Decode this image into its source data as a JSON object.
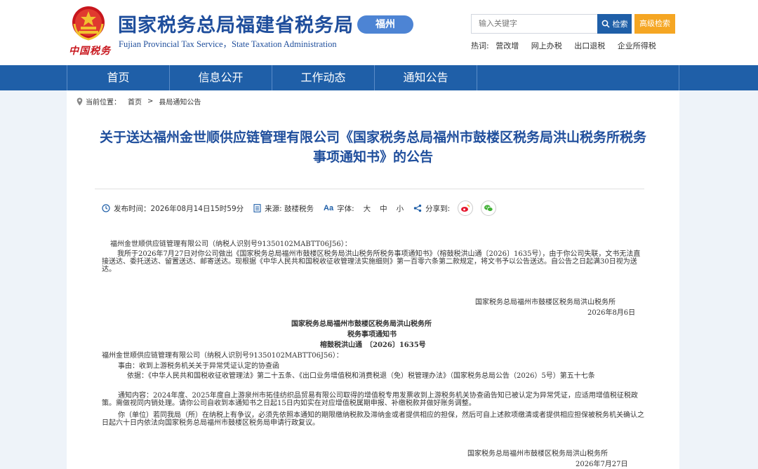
{
  "header": {
    "brand_mark": "中国税务",
    "title": "国家税务总局福建省税务局",
    "subtitle": "Fujian Provincial Tax Service，State Taxation Administration",
    "region_badge": "福州",
    "search": {
      "placeholder": "输入关键字",
      "button_label": "检索",
      "advanced_label": "高级检索"
    },
    "hot": {
      "label": "热词:",
      "items": [
        "营改增",
        "网上办税",
        "出口退税",
        "企业所得税"
      ]
    }
  },
  "nav": {
    "items": [
      "首页",
      "信息公开",
      "工作动态",
      "通知公告"
    ]
  },
  "breadcrumb": {
    "label": "当前位置：",
    "home": "首页",
    "sep": ">",
    "current": "县局通知公告"
  },
  "article": {
    "title": "关于送达福州金世顺供应链管理有限公司《国家税务总局福州市鼓楼区税务局洪山税务所税务事项通知书》的公告",
    "meta": {
      "publish": "发布时间：2026年08月14日15时59分",
      "source": "来源: 鼓楼税务",
      "font_label": "字体:",
      "font_sizes": [
        "大",
        "中",
        "小"
      ],
      "share_label": "分享到:"
    },
    "body": {
      "addressee": "福州金世顺供应链管理有限公司（纳税人识别号91350102MABTT06J56）：",
      "p1": "我所于2026年7月27日对你公司做出《国家税务总局福州市鼓楼区税务局洪山税务所税务事项通知书》（榕鼓税洪山通〔2026〕1635号），由于你公司失联，文书无法直接送达、委托送达、留置送达、邮寄送达。现根据《中华人民共和国税收征收管理法实施细则》第一百零六条第二款规定，将文书予以公告送达。自公告之日起满30日视为送达。",
      "sign1_org": "国家税务总局福州市鼓楼区税务局洪山税务所",
      "sign1_date": "2026年8月6日",
      "notice_org": "国家税务总局福州市鼓楼区税务局洪山税务所",
      "notice_name": "税务事项通知书",
      "notice_no": "榕鼓税洪山通　〔2026〕1635号",
      "notice_addressee": "福州金世顺供应链管理有限公司（纳税人识别号91350102MABTT06J56）：",
      "reason": "事由：收到上游税务机关关于异常凭证认定的协查函",
      "basis": "依据：《中华人民共和国税收征收管理法》第二十五条、《出口业务增值税和消费税退（免）税管理办法》（国家税务总局公告（2026）5号）第五十七条",
      "content": "通知内容：2024年度、2025年度自上游泉州市拓佳纺织品贸易有限公司取得的增值税专用发票收到上游税务机关协查函告知已被认定为异常凭证，应适用增值税征税政策。需做视同内销处理。请你公司自收到本通知书之日起15日内如实在对应增值税属期申报、补缴税款并做好账务调整。",
      "appeal": "你（单位）若同我局（所）在纳税上有争议，必须先依照本通知的期限缴纳税款及滞纳金或者提供相应的担保，然后可自上述款项缴清或者提供相应担保被税务机关确认之日起六十日内依法向国家税务总局福州市鼓楼区税务局申请行政复议。",
      "sign2_org": "国家税务总局福州市鼓楼区税务局洪山税务所",
      "sign2_date": "2026年7月27日"
    }
  },
  "colors": {
    "brand_blue": "#1f4e9c",
    "nav_blue": "#1f5fa8",
    "accent_orange": "#f5a623",
    "badge_blue": "#4d84d4",
    "page_bg": "#eef3f9"
  }
}
